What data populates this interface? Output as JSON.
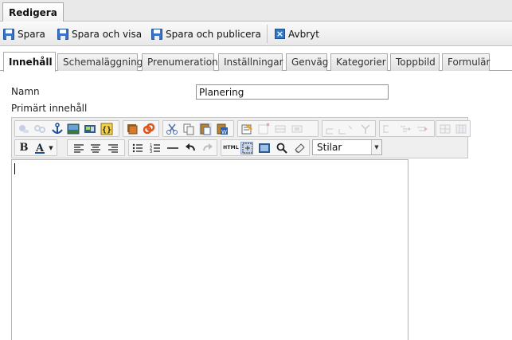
{
  "top_tab": {
    "label": "Redigera"
  },
  "toolbar": {
    "save": "Spara",
    "save_view": "Spara och visa",
    "save_publish": "Spara och publicera",
    "cancel": "Avbryt"
  },
  "tabs": [
    {
      "label": "Innehåll",
      "active": true
    },
    {
      "label": "Schemaläggning"
    },
    {
      "label": "Prenumeration"
    },
    {
      "label": "Inställningar"
    },
    {
      "label": "Genväg"
    },
    {
      "label": "Kategorier"
    },
    {
      "label": "Toppbild"
    },
    {
      "label": "Formulär"
    }
  ],
  "form": {
    "name_label": "Namn",
    "name_value": "Planering",
    "main_content_label": "Primärt innehåll"
  },
  "editor": {
    "styles_value": "Stilar",
    "html_button": "HTML",
    "icons_row1": [
      "insert-link-icon",
      "unlink-icon",
      "anchor-icon",
      "insert-image-icon",
      "insert-media-icon",
      "insert-code-icon",
      "image-gallery-icon",
      "dynamic-content-icon",
      "cut-icon",
      "copy-icon",
      "paste-icon",
      "paste-word-icon",
      "table-properties-icon",
      "insert-row-icon",
      "delete-row-icon",
      "merge-cells-icon",
      "insert-column-icon",
      "split-cells-icon",
      "row-properties-icon",
      "cell-properties-icon",
      "table-icon",
      "table-grid-icon"
    ],
    "icons_row2": [
      "bold-icon",
      "font-color-icon",
      "align-left-icon",
      "align-center-icon",
      "align-right-icon",
      "bullet-list-icon",
      "numbered-list-icon",
      "horizontal-rule-icon",
      "undo-icon",
      "redo-icon",
      "html-source-icon",
      "toggle-guidelines-icon",
      "preview-icon",
      "find-icon",
      "clean-format-icon"
    ]
  },
  "colors": {
    "accent": "#3a72c6",
    "border": "#a9a9a9"
  }
}
